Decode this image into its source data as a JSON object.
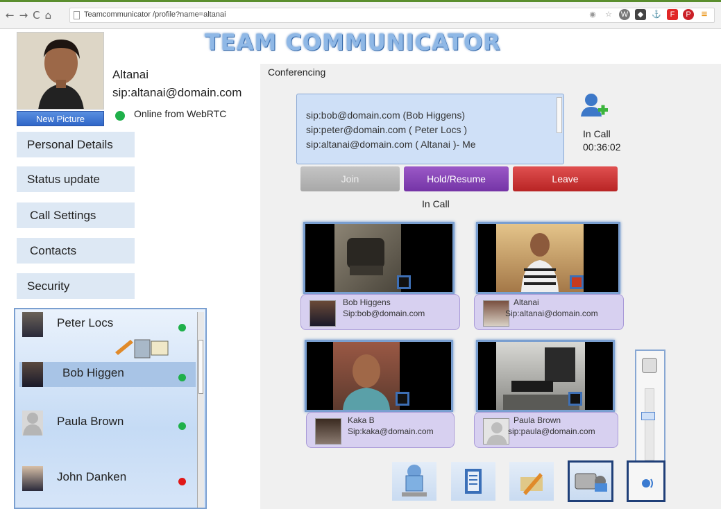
{
  "browser": {
    "url": "Teamcommunicator /profile?name=altanai"
  },
  "app": {
    "title": "TEAM COMMUNICATOR"
  },
  "profile": {
    "new_picture_label": "New Picture",
    "name": "Altanai",
    "sip": "sip:altanai@domain.com",
    "presence": "Online from WebRTC"
  },
  "menu": {
    "items": [
      {
        "label": "Personal Details"
      },
      {
        "label": "Status update"
      },
      {
        "label": "Call Settings"
      },
      {
        "label": "Contacts"
      },
      {
        "label": "Security"
      }
    ]
  },
  "conference": {
    "label": "Conferencing",
    "participants": [
      "sip:bob@domain.com (Bob Higgens)",
      "sip:peter@domain.com ( Peter Locs )",
      "sip:altanai@domain.com ( Altanai )- Me"
    ],
    "call_state": "In Call",
    "call_timer": "00:36:02",
    "join_label": "Join",
    "hold_label": "Hold/Resume",
    "leave_label": "Leave",
    "status_label": "In Call"
  },
  "videos": [
    {
      "name": "Bob Higgens",
      "sip": "Sip:bob@domain.com"
    },
    {
      "name": "Altanai",
      "sip": "Sip:altanai@domain.com"
    },
    {
      "name": "Kaka  B",
      "sip": "Sip:kaka@domain.com"
    },
    {
      "name": "Paula Brown",
      "sip": "sip:paula@domain.com"
    }
  ],
  "contacts": [
    {
      "name": "Peter Locs",
      "status_color": "#1fb04a"
    },
    {
      "name": "Bob Higgen",
      "status_color": "#1fb04a"
    },
    {
      "name": "Paula Brown",
      "status_color": "#1fb04a"
    },
    {
      "name": "John Danken",
      "status_color": "#e01818"
    }
  ],
  "colors": {
    "online": "#1fb04a",
    "offline": "#e01818",
    "hold_button": "#7434a6",
    "leave_button": "#b82424",
    "join_button": "#a8a8a8",
    "accent": "#2f66c8"
  },
  "icons": {
    "nav": [
      "back-icon",
      "forward-icon",
      "reload-icon",
      "home-icon"
    ],
    "toolbar": [
      "screen-share-icon",
      "notes-icon",
      "pen-icon",
      "video-camera-icon",
      "volume-icon"
    ]
  }
}
